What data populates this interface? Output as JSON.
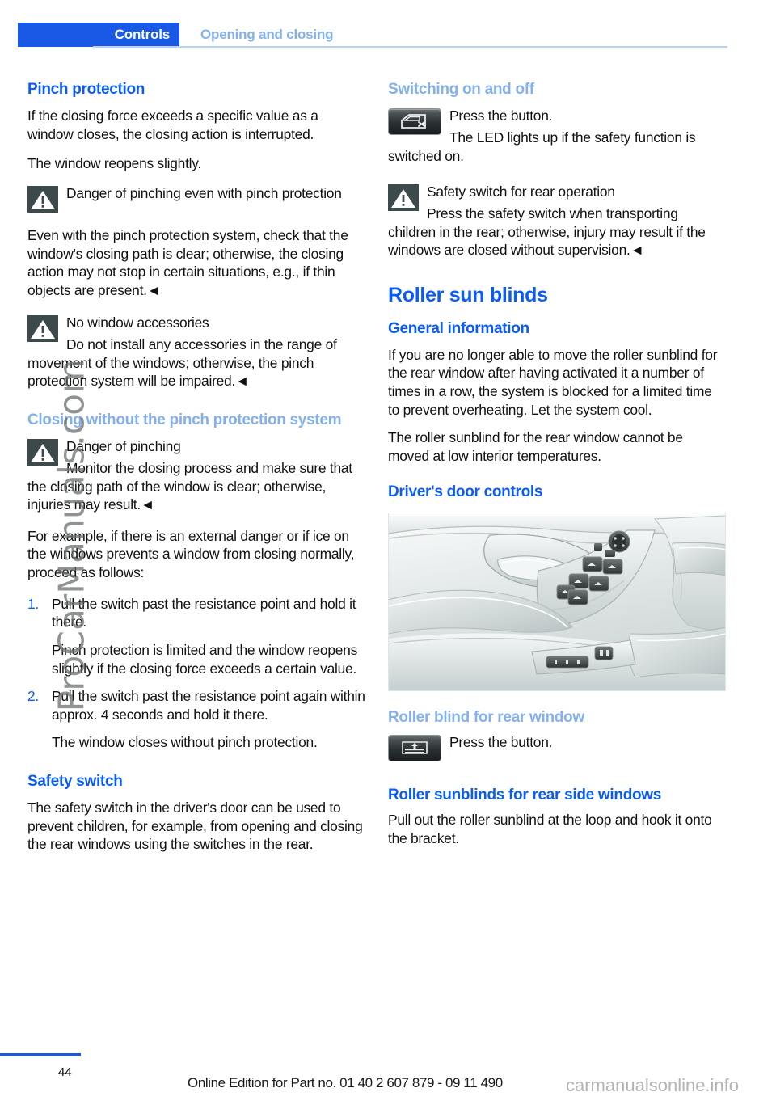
{
  "header": {
    "chapter": "Controls",
    "section": "Opening and closing"
  },
  "left_column": {
    "h_pinch_protection": "Pinch protection",
    "p_intro": "If the closing force exceeds a specific value as a window closes, the closing action is interrupted.",
    "p_reopens": "The window reopens slightly.",
    "warn1_title": "Danger of pinching even with pinch protection",
    "warn1_body": "Even with the pinch protection system, check that the window's closing path is clear; otherwise, the closing action may not stop in certain situations, e.g., if thin objects are present.◄",
    "warn2_title": "No window accessories",
    "warn2_body": "Do not install any accessories in the range of movement of the windows; otherwise, the pinch protection system will be impaired.◄",
    "h_closing_without": "Closing without the pinch protection system",
    "warn3_title": "Danger of pinching",
    "warn3_body": "Monitor the closing process and make sure that the closing path of the window is clear; otherwise, injuries may result.◄",
    "p_for_example": "For example, if there is an external danger or if ice on the windows prevents a window from closing normally, proceed as follows:",
    "steps": [
      {
        "num": "1.",
        "text": "Pull the switch past the resistance point and hold it there.",
        "note": "Pinch protection is limited and the window reopens slightly if the closing force exceeds a certain value."
      },
      {
        "num": "2.",
        "text": "Pull the switch past the resistance point again within approx. 4 seconds and hold it there.",
        "note": "The window closes without pinch protection."
      }
    ],
    "h_safety_switch": "Safety switch",
    "p_safety_switch": "The safety switch in the driver's door can be used to prevent children, for example, from opening and closing the rear windows using the switches in the rear."
  },
  "right_column": {
    "h_switching": "Switching on and off",
    "btn_press": "Press the button.",
    "p_led": "The LED lights up if the safety function is switched on.",
    "warn_title": "Safety switch for rear operation",
    "warn_body": "Press the safety switch when transporting children in the rear; otherwise, injury may result if the windows are closed without supervision.◄",
    "h_roller_sun_blinds": "Roller sun blinds",
    "h_general_information": "General information",
    "p_general_1": "If you are no longer able to move the roller sunblind for the rear window after having activated it a number of times in a row, the system is blocked for a limited time to prevent overheating. Let the system cool.",
    "p_general_2": "The roller sunblind for the rear window cannot be moved at low interior temperatures.",
    "h_drivers_door_controls": "Driver's door controls",
    "h_roller_blind_rear": "Roller blind for rear window",
    "btn_press2": "Press the button.",
    "h_roller_sunblinds_side": "Roller sunblinds for rear side windows",
    "p_sunblinds_side": "Pull out the roller sunblind at the loop and hook it onto the bracket."
  },
  "footer": {
    "page_number": "44",
    "edition": "Online Edition for Part no. 01 40 2 607 879 - 09 11 490"
  },
  "watermarks": {
    "vertical": "ProCarManuals.com",
    "corner": "carmanualsonline.info"
  },
  "colors": {
    "accent_blue": "#0a5cf5",
    "tab_blue": "#1959e6",
    "light_blue": "#84b0ee",
    "warn_icon_bg": "#3c4a4c"
  }
}
